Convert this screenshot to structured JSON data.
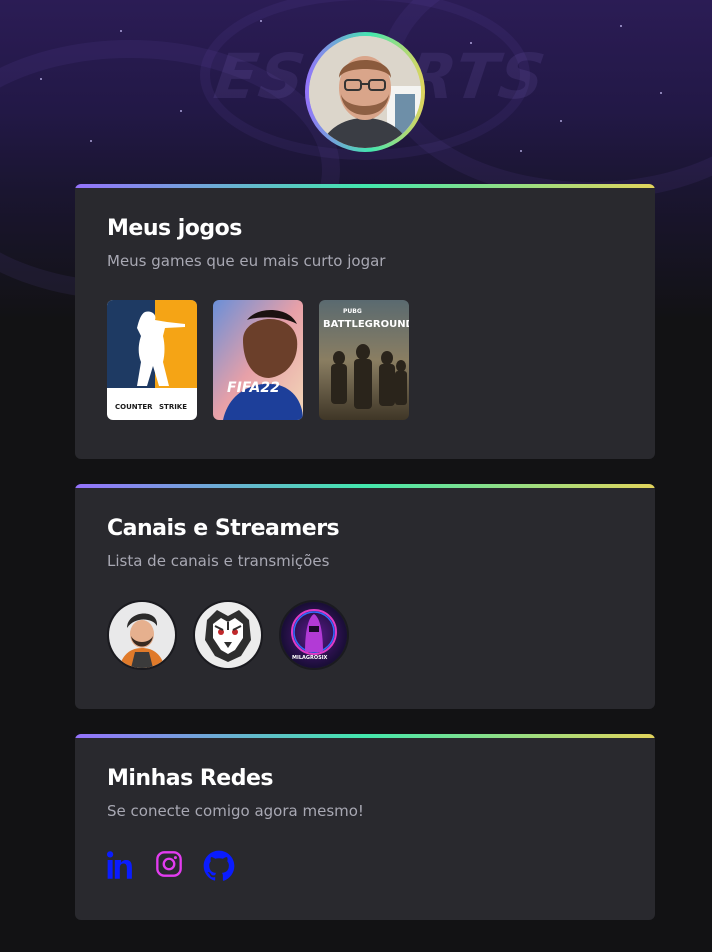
{
  "profile": {
    "avatar_icon": "profile-photo"
  },
  "background": {
    "logo_text": "ESPORTS"
  },
  "games_card": {
    "title": "Meus jogos",
    "subtitle": "Meus games que eu mais curto jogar",
    "games": [
      {
        "name": "Counter Strike",
        "label_main": "COUNTER",
        "label_strike": "STRIKE"
      },
      {
        "name": "FIFA 22",
        "label": "FIFA22"
      },
      {
        "name": "PUBG Battlegrounds",
        "label_top": "PUBG",
        "label": "BATTLEGROUNDS"
      }
    ]
  },
  "channels_card": {
    "title": "Canais e Streamers",
    "subtitle": "Lista de canais e transmições",
    "streamers": [
      {
        "name": "streamer-1"
      },
      {
        "name": "streamer-2"
      },
      {
        "name": "streamer-3",
        "label": "MILAGROSIX"
      }
    ]
  },
  "social_card": {
    "title": "Minhas Redes",
    "subtitle": "Se conecte comigo agora mesmo!",
    "links": [
      {
        "name": "linkedin",
        "color": "#0a1cff"
      },
      {
        "name": "instagram",
        "color": "#e33cf0"
      },
      {
        "name": "github",
        "color": "#0a1cff"
      }
    ]
  },
  "colors": {
    "card_bg": "#29292e",
    "page_bg": "#121214",
    "gradient": [
      "#9572fc",
      "#43e7ad",
      "#e2d45c"
    ],
    "subtitle": "#a8a8b3"
  }
}
